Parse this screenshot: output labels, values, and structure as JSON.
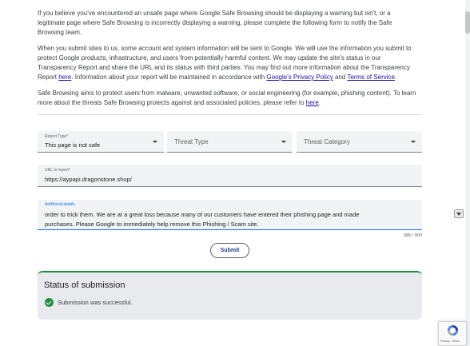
{
  "intro": {
    "p1": "If you believe you've encountered an unsafe page where Google Safe Browsing should be displaying a warning but isn't, or a legitimate page where Safe Browsing is incorrectly displaying a warning, please complete the following form to notify the Safe Browsing team.",
    "p2_before_here": "When you submit sites to us, some account and system information will be sent to Google. We will use the information you submit to protect Google products, infrastructure, and users from potentially harmful content. We may update the site's status in our Transparency Report and share the URL and its status with third parties. You may find out more information about the Transparency Report ",
    "p2_here": "here",
    "p2_mid": ". Information about your report will be maintained in accordance with ",
    "p2_privacy": "Google's Privacy Policy",
    "p2_and": " and ",
    "p2_terms": "Terms of Service",
    "p2_end": ".",
    "p3_before": "Safe Browsing aims to protect users from malware, unwanted software, or social engineering (for example, phishing content). To learn more about the threats Safe Browsing protects against and associated policies, please refer to ",
    "p3_here": "here",
    "p3_end": "."
  },
  "form": {
    "report_type": {
      "label": "Report Type*",
      "value": "This page is not safe"
    },
    "threat_type": {
      "placeholder": "Threat Type"
    },
    "threat_category": {
      "placeholder": "Threat Category"
    },
    "url": {
      "label": "URL to report*",
      "value": "https://aypapi.dragonstone.shop/"
    },
    "details": {
      "label": "Additional details",
      "line1": "order to trick them. We are at a great loss because many of our customers have entered their phishing page and made",
      "line2": "purchases. Please Google to immediately help remove this Phishing / Scam site.",
      "counter": "685 / 800"
    },
    "submit_label": "Submit"
  },
  "status": {
    "title": "Status of submission",
    "message": "Submission was successful."
  },
  "recaptcha": {
    "text": "Privacy - Terms"
  },
  "colors": {
    "accent": "#1a73e8",
    "success": "#1e8e3e",
    "link": "#1a0dab"
  }
}
